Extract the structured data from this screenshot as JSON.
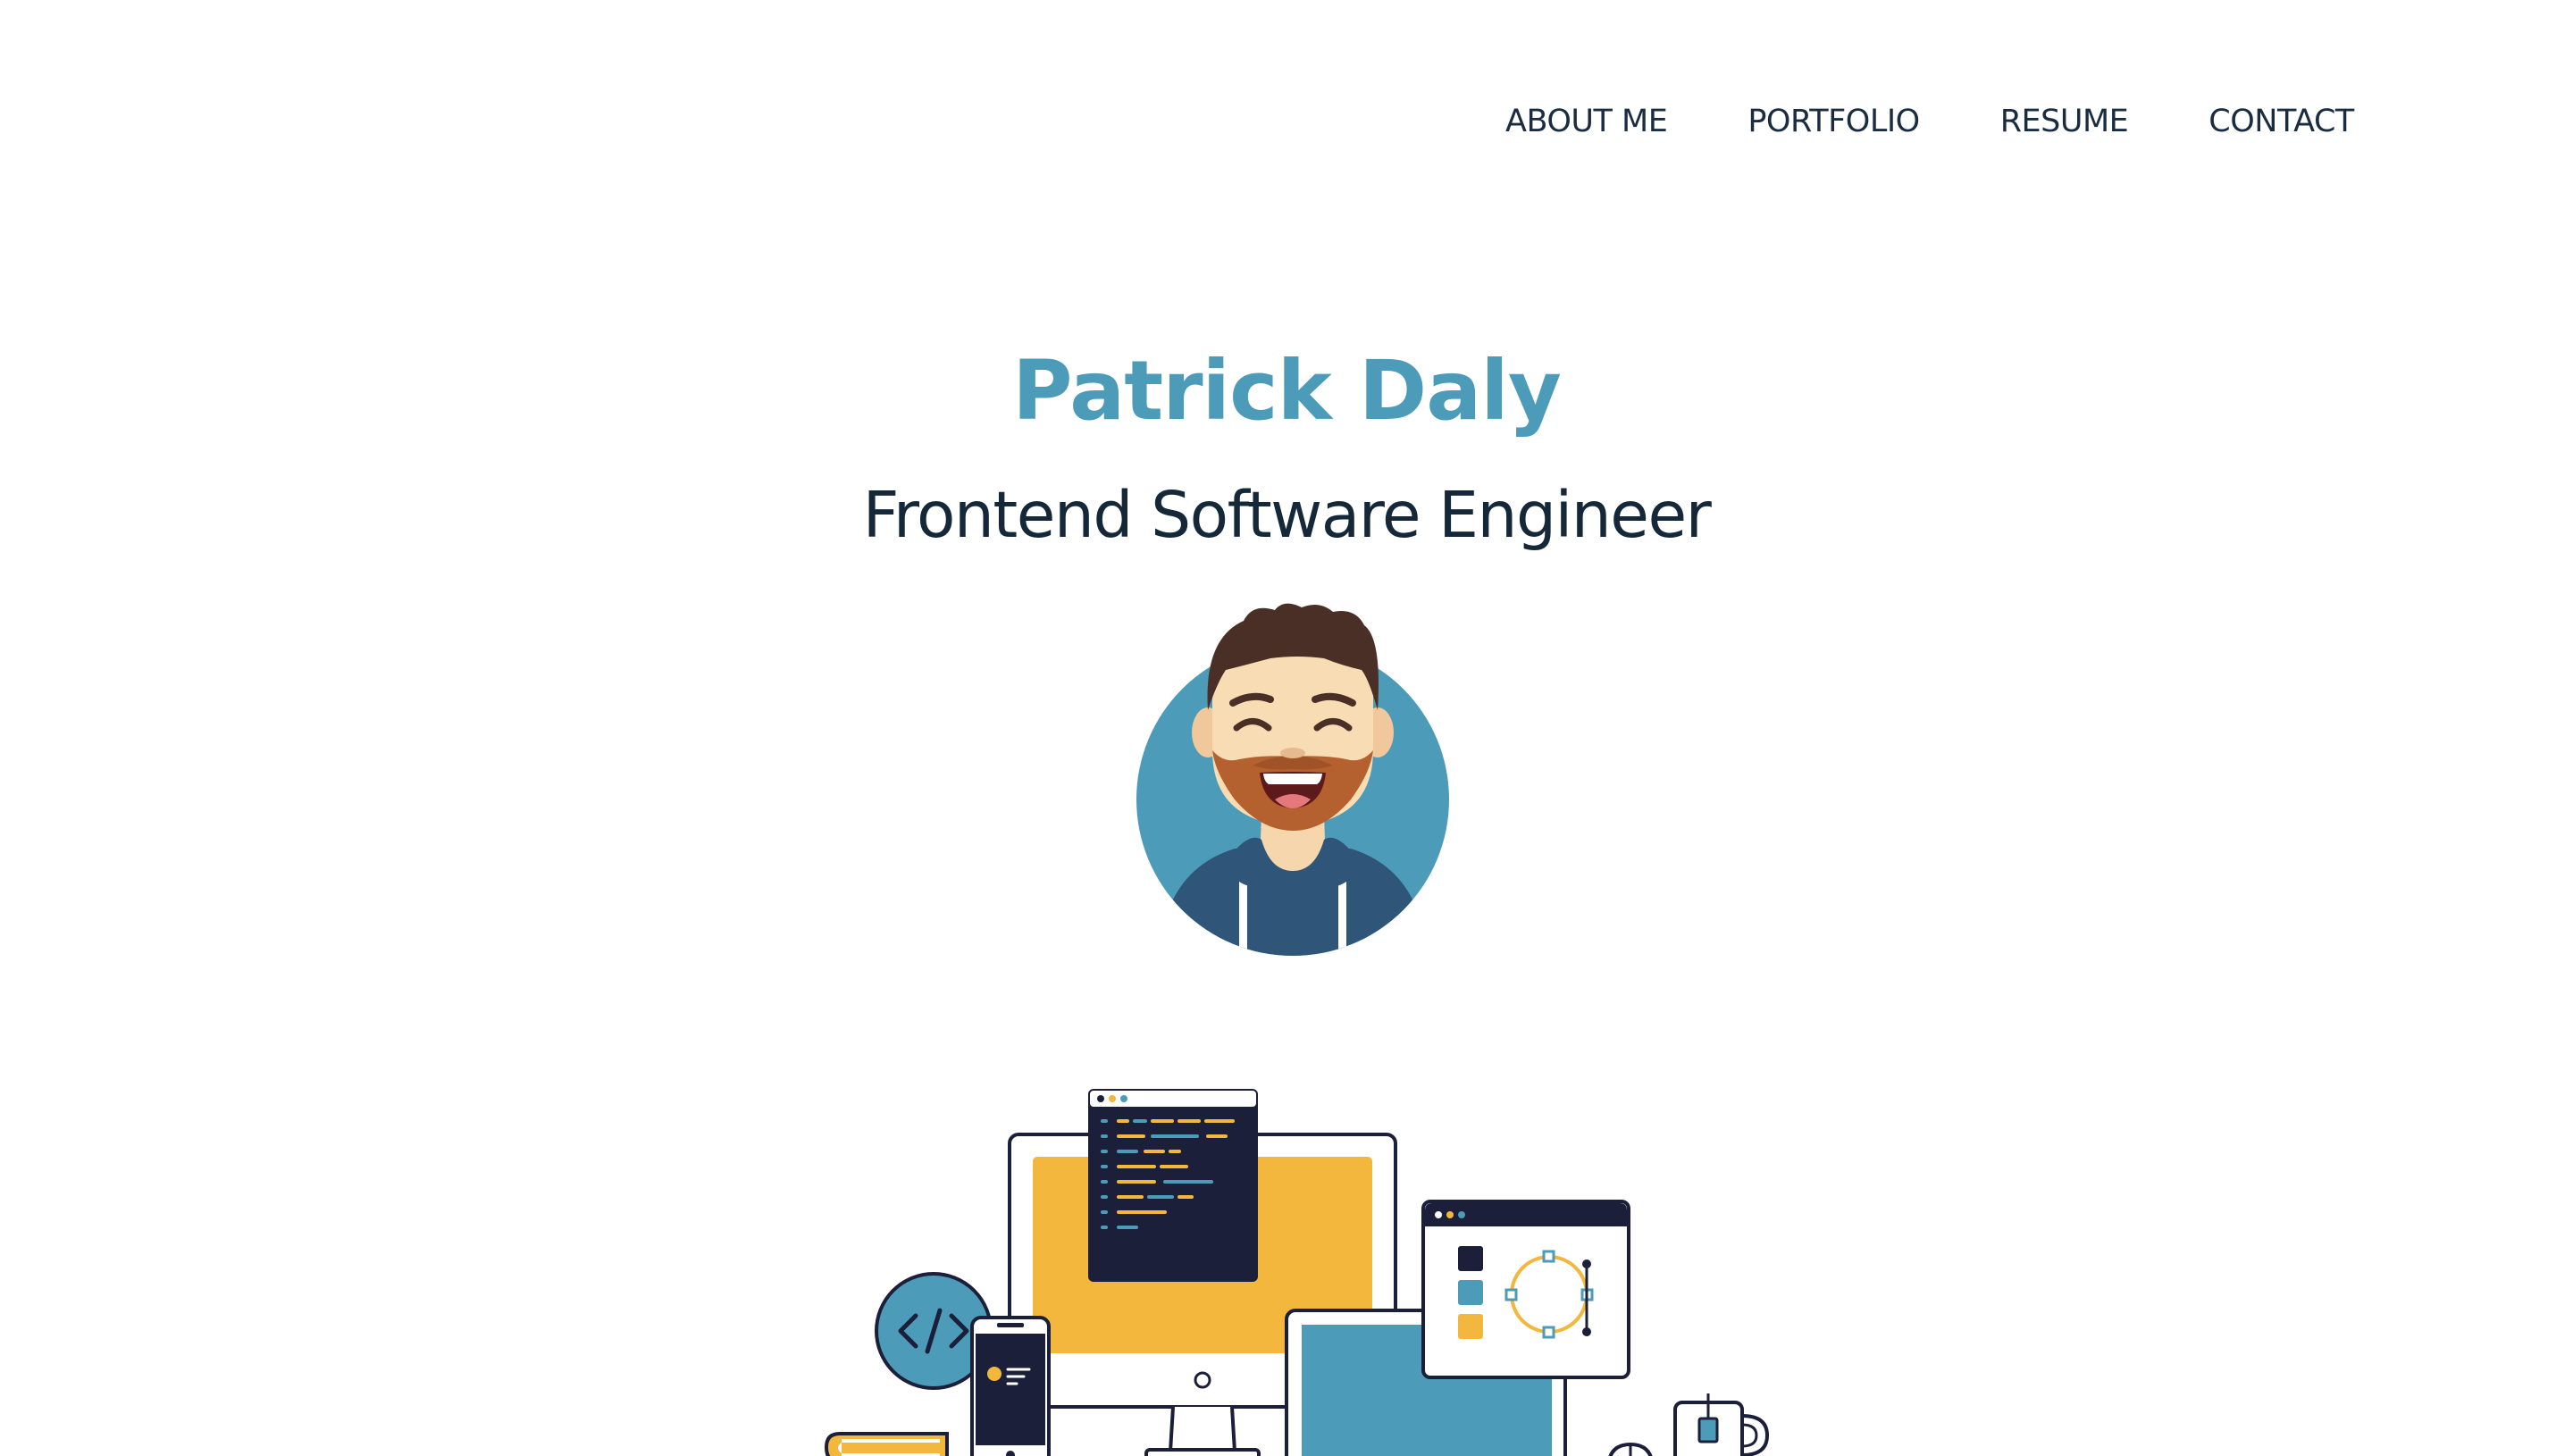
{
  "nav": {
    "items": [
      {
        "label": "ABOUT ME"
      },
      {
        "label": "PORTFOLIO"
      },
      {
        "label": "RESUME"
      },
      {
        "label": "CONTACT"
      }
    ]
  },
  "hero": {
    "name": "Patrick Daly",
    "title": "Frontend Software Engineer"
  },
  "colors": {
    "accent": "#4c9bb9",
    "navy": "#14283a",
    "yellow": "#f4b73d",
    "dark": "#1b1f3a"
  },
  "icons": {
    "avatar": "smiling-bearded-man-avatar",
    "illustration": "developer-devices-illustration"
  }
}
